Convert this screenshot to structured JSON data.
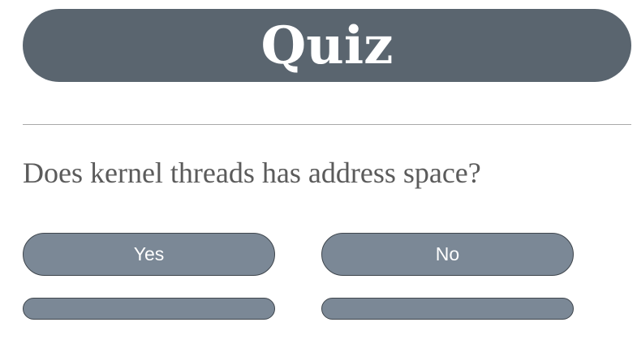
{
  "quiz": {
    "title": "Quiz",
    "question": "Does kernel threads has address space?",
    "answers": [
      {
        "label": "Yes"
      },
      {
        "label": "No"
      },
      {
        "label": ""
      },
      {
        "label": ""
      }
    ]
  },
  "colors": {
    "title_bar": "#5a656f",
    "button": "#7b8896",
    "button_border": "#3f464d",
    "question_text": "#5b5b5b",
    "divider": "#a9a9a9"
  }
}
